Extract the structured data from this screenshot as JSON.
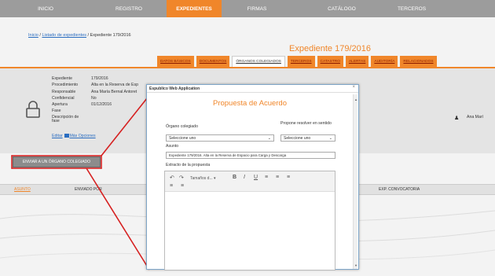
{
  "nav": {
    "items": [
      "INICIO",
      "REGISTRO",
      "EXPEDIENTES",
      "FIRMAS",
      "CATÁLOGO",
      "TERCEROS"
    ],
    "active_index": 2
  },
  "breadcrumb": {
    "home": "Inicio",
    "sep1": " / ",
    "list": "Listado de expedientes",
    "sep2": " / ",
    "current": "Expediente 179/2016"
  },
  "page_title": "Expediente 179/2016",
  "tabs": [
    "DATOS BÁSICOS",
    "DOCUMENTOS",
    "ÓRGANOS COLEGIADOS",
    "TERCEROS",
    "CATASTRO",
    "ALERTAS",
    "AUDITORÍA",
    "RELACIONADOS"
  ],
  "active_tab": 2,
  "info": {
    "labels": [
      "Expediente",
      "Procedimiento",
      "Responsable",
      "Confidencial",
      "Apertura",
      "Fase",
      "Descripción de fase"
    ],
    "values": [
      "179/2016",
      "Alta en la Reserva de Esp",
      "Ana María Bernal Antoret",
      "No",
      "01/12/2016",
      "",
      ""
    ],
    "edit": "Editar",
    "more": "Más Opciones"
  },
  "right_user": "Ana Marí",
  "send_button": "ENVIAR A UN ÓRGANO COLEGIADO",
  "table": {
    "col_asunto": "ASUNTO",
    "col_enviado": "ENVIADO POR",
    "col_conv": "EXP. CONVOCATORIA"
  },
  "modal": {
    "window_title": "Espublico Web Application",
    "close": "×",
    "title": "Propuesta de Acuerdo",
    "organo_label": "Órgano colegiado",
    "organo_value": "Seleccione uno",
    "propone_label": "Propone resolver en sentido",
    "propone_value": "Seleccione uno",
    "asunto_label": "Asunto",
    "asunto_value": "Expediente 179/2016. Alta en la Reserva de Espacio para Carga y Descarga",
    "extracto_label": "Extracto de la propuesta",
    "font_size_label": "Tamaños d..."
  }
}
